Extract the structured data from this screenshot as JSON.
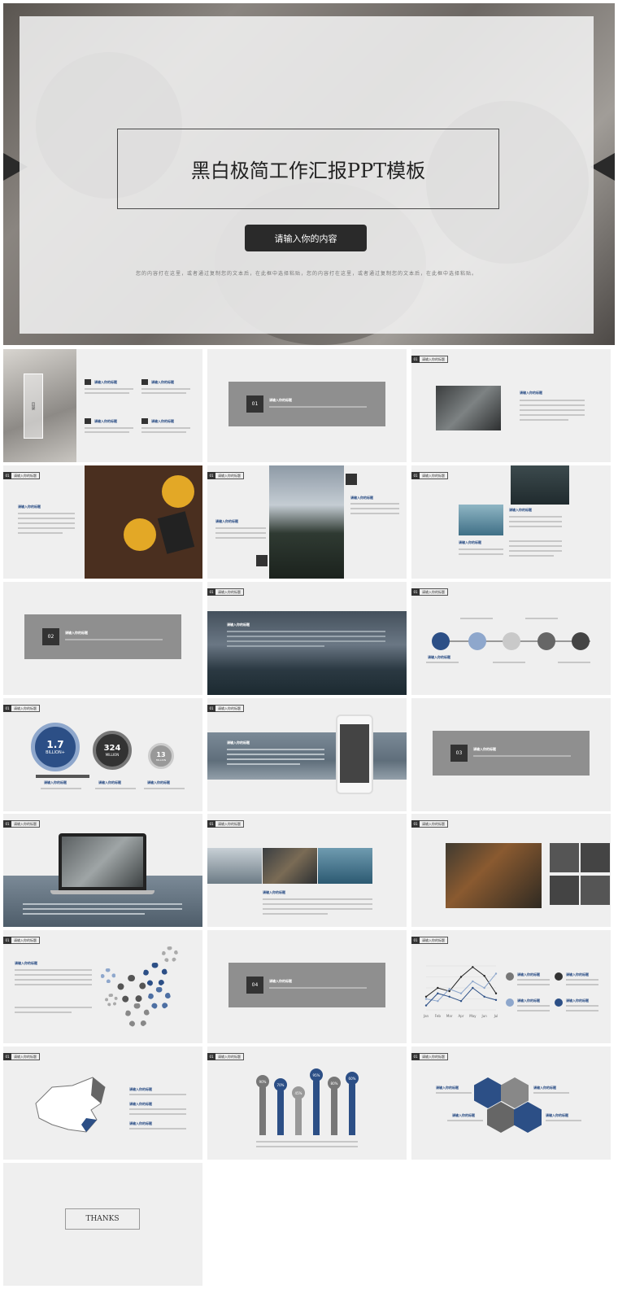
{
  "hero": {
    "title": "黑白极简工作汇报PPT模板",
    "button": "请输入你的内容",
    "desc": "您的内容打在这里，或者通过复制您的文本后，在此框中选择粘贴，您的内容打在这里，或者通过复制您的文本后，在此框中选择粘贴。"
  },
  "slides": {
    "placeholder_title": "请输入你的标题",
    "toc_heading": "请输入你的标题",
    "section_numbers": [
      "01",
      "02",
      "03",
      "04"
    ],
    "stats": [
      {
        "value": "1.7",
        "unit": "BILLION+"
      },
      {
        "value": "324",
        "unit": "MILLION"
      },
      {
        "value": "13",
        "unit": "MILLION"
      }
    ],
    "bar_labels": [
      "90%",
      "70%",
      "45%",
      "95%",
      "80%",
      "60%"
    ],
    "toc_side": "目录",
    "thanks": "THANKS",
    "tag_num": "01"
  },
  "colors": {
    "blue": "#2c4f86",
    "dark": "#333333",
    "grey": "#8f8f8f"
  },
  "chart_data": {
    "type": "line",
    "categories": [
      "Jan",
      "Feb",
      "Mar",
      "Apr",
      "May",
      "Jun",
      "Jul"
    ],
    "series": [
      {
        "values": [
          120,
          200,
          170,
          300,
          390,
          310,
          150
        ]
      },
      {
        "values": [
          100,
          80,
          190,
          150,
          260,
          200,
          330
        ]
      },
      {
        "values": [
          40,
          150,
          120,
          80,
          200,
          120,
          90
        ]
      }
    ],
    "ylim": [
      0,
      400
    ]
  }
}
